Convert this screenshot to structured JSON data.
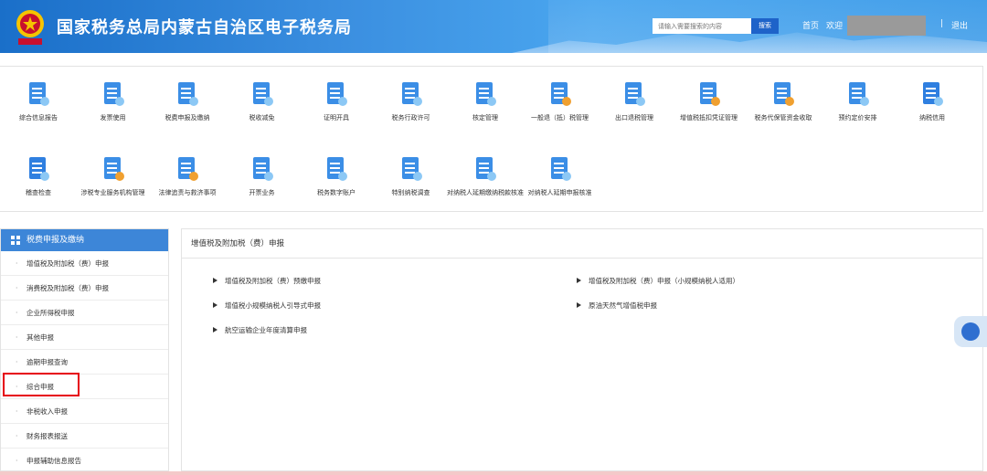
{
  "header": {
    "title": "国家税务总局内蒙古自治区电子税务局",
    "search_placeholder": "请输入需要搜索的内容",
    "search_button": "搜索",
    "home": "首页",
    "welcome": "欢迎",
    "separator": "|",
    "logout": "退出"
  },
  "menu_grid": [
    {
      "label": "综合信息报告",
      "icon": "report-doc-icon"
    },
    {
      "label": "发票使用",
      "icon": "invoice-icon"
    },
    {
      "label": "税费申报及缴纳",
      "icon": "tax-declare-icon"
    },
    {
      "label": "税收减免",
      "icon": "tax-relief-icon"
    },
    {
      "label": "证明开具",
      "icon": "certificate-icon"
    },
    {
      "label": "税务行政许可",
      "icon": "admin-permit-icon"
    },
    {
      "label": "核定管理",
      "icon": "verification-icon"
    },
    {
      "label": "一般退（抵）税管理",
      "icon": "refund-icon"
    },
    {
      "label": "出口退税管理",
      "icon": "export-refund-icon"
    },
    {
      "label": "增值税抵扣凭证管理",
      "icon": "vat-voucher-icon"
    },
    {
      "label": "税务代保管资金收取",
      "icon": "custody-fund-icon"
    },
    {
      "label": "预约定价安排",
      "icon": "pricing-icon"
    },
    {
      "label": "纳税信用",
      "icon": "credit-icon"
    },
    {
      "label": "稽查检查",
      "icon": "inspection-icon"
    },
    {
      "label": "涉税专业服务机构管理",
      "icon": "agency-icon"
    },
    {
      "label": "法律追责与救济事项",
      "icon": "legal-icon"
    },
    {
      "label": "开票业务",
      "icon": "billing-icon"
    },
    {
      "label": "税务数字账户",
      "icon": "digital-account-icon"
    },
    {
      "label": "特别纳税调查",
      "icon": "special-investigation-icon"
    },
    {
      "label": "对纳税人延期缴纳税款核准",
      "icon": "deferred-payment-icon"
    },
    {
      "label": "对纳税人延期申报核准",
      "icon": "deferred-declare-icon"
    }
  ],
  "sidebar": {
    "title": "税费申报及缴纳",
    "items": [
      "增值税及附加税（费）申报",
      "消费税及附加税（费）申报",
      "企业所得税申报",
      "其他申报",
      "逾期申报查询",
      "综合申报",
      "非税收入申报",
      "财务报表报送",
      "申报辅助信息报告"
    ]
  },
  "main": {
    "title": "增值税及附加税（费）申报",
    "links": [
      "增值税及附加税（费）预缴申报",
      "增值税及附加税（费）申报（小规模纳税人适用）",
      "增值税小规模纳税人引导式申报",
      "原油天然气增值税申报",
      "航空运输企业年度清算申报"
    ]
  },
  "colors": {
    "header_blue": "#2f86dc",
    "accent": "#3d86d8",
    "highlight": "#e60012"
  }
}
